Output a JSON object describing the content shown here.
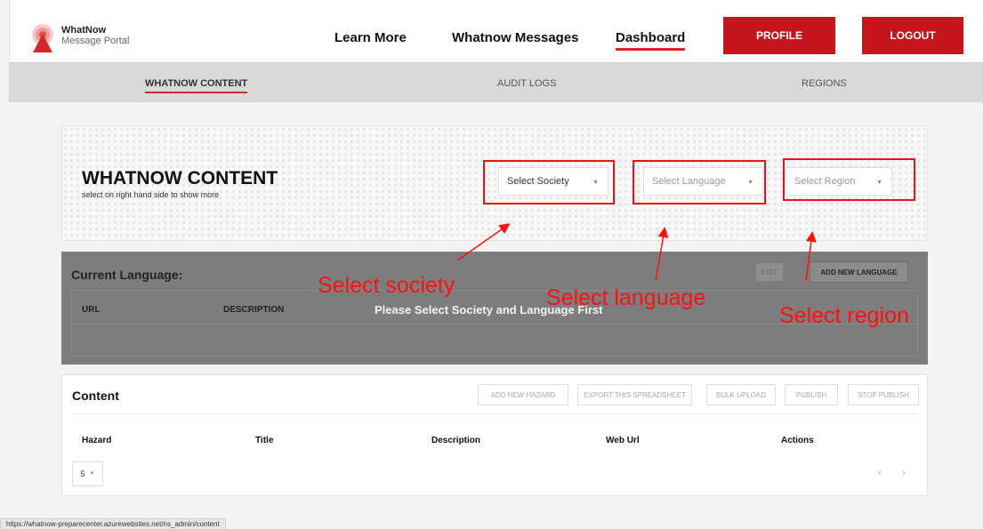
{
  "brand": {
    "name": "WhatNow",
    "tagline": "Message Portal"
  },
  "nav": {
    "learn_more": "Learn More",
    "messages": "Whatnow Messages",
    "dashboard": "Dashboard",
    "profile": "PROFILE",
    "logout": "LOGOUT"
  },
  "subnav": {
    "content": "WHATNOW CONTENT",
    "audit": "AUDIT LOGS",
    "regions": "REGIONS"
  },
  "hero": {
    "title": "WHATNOW CONTENT",
    "subtitle": "select on right hand side to show more",
    "society_select": "Select Society",
    "language_select": "Select Language",
    "region_select": "Select Region"
  },
  "language_panel": {
    "title": "Current Language:",
    "edit": "EDIT",
    "add_language": "ADD NEW LANGUAGE",
    "col_url": "URL",
    "col_description": "DESCRIPTION",
    "message": "Please Select Society and Language First"
  },
  "content": {
    "title": "Content",
    "buttons": {
      "add_hazard": "ADD NEW HAZARD",
      "export": "EXPORT THIS SPREADSHEET",
      "bulk_upload": "BULK UPLOAD",
      "publish": "PUBLISH",
      "stop_publish": "STOP PUBLISH"
    },
    "columns": {
      "hazard": "Hazard",
      "title": "Title",
      "description": "Description",
      "web_url": "Web Url",
      "actions": "Actions"
    },
    "page_size": "5",
    "prev": "‹",
    "next": "›"
  },
  "annotations": {
    "society": "Select society",
    "language": "Select language",
    "region": "Select region"
  },
  "status_url": "https://whatnow-preparecenter.azurewebsites.net/ns_admin/content",
  "colors": {
    "brand_red": "#c4161c",
    "annotation_red": "#ff1010"
  }
}
